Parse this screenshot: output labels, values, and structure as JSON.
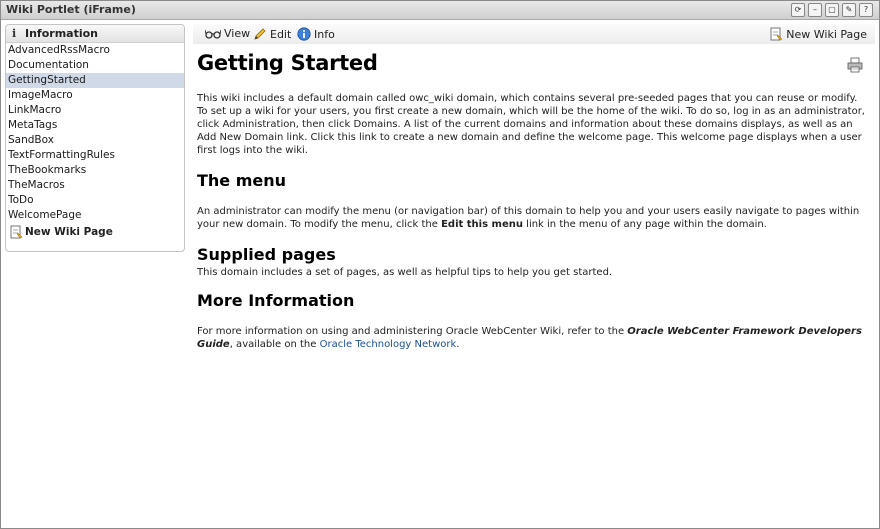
{
  "window": {
    "title": "Wiki Portlet (iFrame)"
  },
  "sidebar": {
    "header": "Information",
    "items": [
      "AdvancedRssMacro",
      "Documentation",
      "GettingStarted",
      "ImageMacro",
      "LinkMacro",
      "MetaTags",
      "SandBox",
      "TextFormattingRules",
      "TheBookmarks",
      "TheMacros",
      "ToDo",
      "WelcomePage"
    ],
    "selected_index": 2,
    "new_page_label": "New Wiki Page"
  },
  "toolbar": {
    "view_label": "View",
    "edit_label": "Edit",
    "info_label": "Info",
    "new_page_label": "New Wiki Page"
  },
  "page": {
    "title": "Getting Started",
    "intro": "This wiki includes a default domain called owc_wiki domain, which contains several pre-seeded pages that you can reuse or modify. To set up a wiki for your users, you first create a new domain, which will be the home of the wiki. To do so, log in as an administrator, click Administration, then click Domains. A list of the current domains and information about these domains displays, as well as an Add New Domain link. Click this link to create a new domain and define the welcome page. This welcome page displays when a user first logs into the wiki.",
    "menu_heading": "The menu",
    "menu_text_before": "An administrator can modify the menu (or navigation bar) of this domain to help you and your users easily navigate to pages within your new domain. To modify the menu, click the ",
    "menu_text_bold": "Edit this menu",
    "menu_text_after": " link in the menu of any page within the domain.",
    "supplied_heading": "Supplied pages",
    "supplied_text": "This domain includes a set of pages, as well as helpful tips to help you get started.",
    "more_heading": "More Information",
    "more_text_before": "For more information on using and administering Oracle WebCenter Wiki, refer to the ",
    "more_text_guide": "Oracle WebCenter Framework Developers Guide",
    "more_text_middle": ", available on the ",
    "more_text_link": "Oracle Technology Network",
    "more_text_after": "."
  },
  "colors": {
    "selected_row": "#cfd9e8",
    "link": "#1f4e99"
  },
  "icons": [
    "glasses-icon",
    "pencil-icon",
    "info-icon",
    "new-page-icon",
    "print-icon"
  ]
}
